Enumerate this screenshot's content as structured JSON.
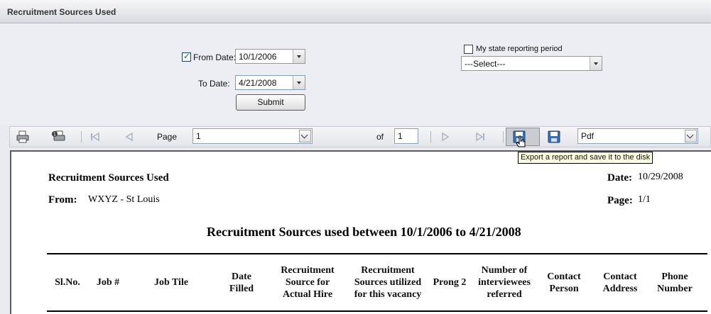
{
  "window": {
    "title": "Recruitment Sources Used"
  },
  "filters": {
    "from_date_label": "From Date:",
    "from_date_value": "10/1/2006",
    "from_date_checked": true,
    "to_date_label": "To Date:",
    "to_date_value": "4/21/2008",
    "submit_label": "Submit",
    "state_period_label": "My state reporting period",
    "state_period_checked": false,
    "state_period_select": "---Select---"
  },
  "toolbar": {
    "page_label": "Page",
    "page_value": "1",
    "of_label": "of",
    "total_pages": "1",
    "export_format": "Pdf",
    "export_tooltip": "Export a report and save it to the disk",
    "icons": [
      "print-icon",
      "print-setup-icon",
      "first-page-icon",
      "previous-page-icon",
      "next-page-icon",
      "last-page-icon",
      "export-save-icon",
      "save-disk-icon"
    ]
  },
  "report": {
    "title": "Recruitment Sources Used",
    "from_label": "From:",
    "from_value": "WXYZ - St Louis",
    "date_label": "Date:",
    "date_value": "10/29/2008",
    "page_label": "Page:",
    "page_value": "1/1",
    "heading": "Recruitment Sources used between 10/1/2006 to 4/21/2008",
    "columns": [
      [
        "Sl.No."
      ],
      [
        "Job #"
      ],
      [
        "Job Tile"
      ],
      [
        "Date",
        "Filled"
      ],
      [
        "Recruitment",
        "Source for",
        "Actual Hire"
      ],
      [
        "Recruitment",
        "Sources utilized",
        "for this vacancy"
      ],
      [
        "Prong 2"
      ],
      [
        "Number of",
        "interviewees",
        "referred"
      ],
      [
        "Contact",
        "Person"
      ],
      [
        "Contact",
        "Address"
      ],
      [
        "Phone",
        "Number"
      ]
    ]
  }
}
